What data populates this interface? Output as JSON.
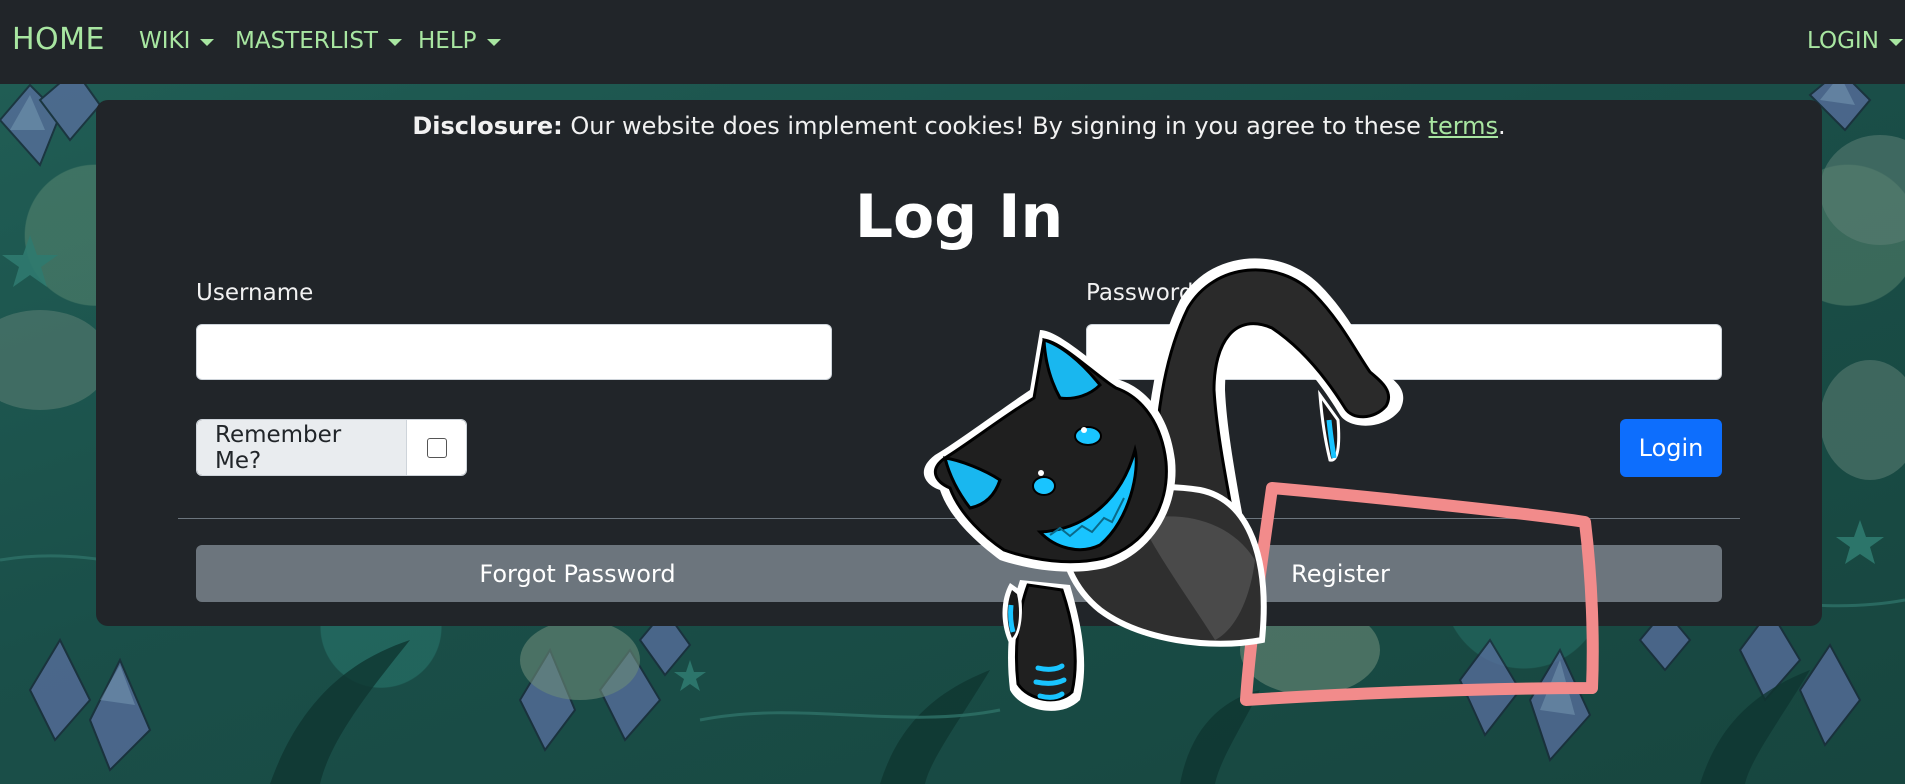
{
  "navbar": {
    "home": "HOME",
    "items": [
      {
        "label": "WIKI"
      },
      {
        "label": "MASTERLIST"
      },
      {
        "label": "HELP"
      }
    ],
    "login": "LOGIN"
  },
  "disclosure": {
    "bold": "Disclosure:",
    "text": " Our website does implement cookies! By signing in you agree to these ",
    "link": "terms",
    "end": "."
  },
  "form": {
    "title": "Log In",
    "username_label": "Username",
    "username_value": "",
    "password_label": "Password",
    "password_value": "",
    "remember_label": "Remember Me?",
    "remember_checked": false,
    "login_button": "Login",
    "forgot_button": "Forgot Password",
    "register_button": "Register"
  },
  "colors": {
    "navbar_bg": "#212529",
    "nav_link": "#a8e6a1",
    "primary": "#0d6efd",
    "secondary": "#6c757d",
    "annotation": "#f28b8b"
  },
  "icons": [
    "caret-down-icon",
    "cat-mascot-sticker",
    "highlight-rectangle-annotation"
  ]
}
